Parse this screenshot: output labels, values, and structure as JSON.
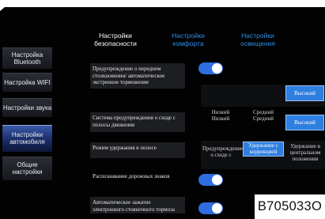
{
  "tabs": [
    {
      "label": "Настройки безопасности"
    },
    {
      "label": "Настройки комфорта"
    },
    {
      "label": "Настройки освещения"
    }
  ],
  "sidebar": {
    "items": [
      {
        "label": "Настройка Bluetooth"
      },
      {
        "label": "Настройка WIFI"
      },
      {
        "label": "Настройки звука"
      },
      {
        "label": "Настройки автомобиля"
      },
      {
        "label": "Общие настройки"
      }
    ]
  },
  "settings": {
    "forward_collision": {
      "label": "Предупреждение о переднем столкновении/ автоматическое экстренное торможение",
      "on": true
    },
    "sensitivity_options": {
      "low": "Низкий",
      "mid": "Средний",
      "high": "Высокий",
      "selected": "Высокий"
    },
    "lane_departure": {
      "label": "Система предупреждения о сходе с полосы движения"
    },
    "lane_departure_options": {
      "low": "Низкий",
      "mid": "Средний",
      "high": "Высокий",
      "selected": "Высокий"
    },
    "lane_keep": {
      "label": "Режим удержания в полосе"
    },
    "lane_keep_options": {
      "warn": "Предупреждение о сходе с",
      "correct": "Удержание с коррекцией",
      "center": "Удержание в центральном положении",
      "selected": "Удержание с коррекцией"
    },
    "sign_recognition": {
      "label": "Распознавание дорожных знаков",
      "on": true
    },
    "auto_hold": {
      "label": "Автоматическое зажатие электронного стояночного тормоза",
      "on": true
    }
  },
  "code": "B705033O",
  "colors": {
    "accent": "#2f6ee0",
    "background": "#020203",
    "tab_inactive": "#2f8ee6"
  }
}
